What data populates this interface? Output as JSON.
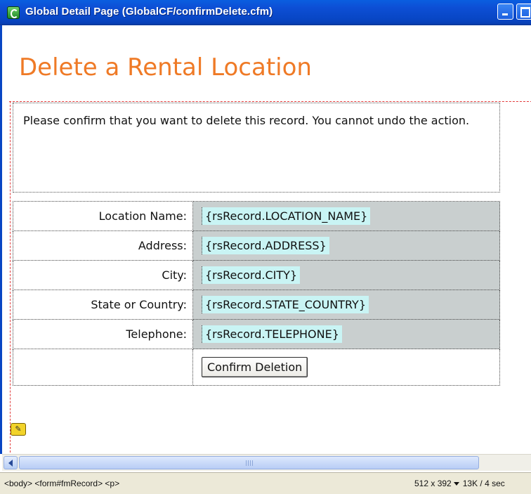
{
  "window": {
    "title": "Global Detail Page (GlobalCF/confirmDelete.cfm)"
  },
  "page": {
    "title": "Delete a Rental Location",
    "confirm_message": "Please confirm that you want to delete this record. You cannot undo the action."
  },
  "form": {
    "fields": [
      {
        "label": "Location Name:",
        "value": "{rsRecord.LOCATION_NAME}"
      },
      {
        "label": "Address:",
        "value": "{rsRecord.ADDRESS}"
      },
      {
        "label": "City:",
        "value": "{rsRecord.CITY}"
      },
      {
        "label": "State or Country:",
        "value": "{rsRecord.STATE_COUNTRY}"
      },
      {
        "label": "Telephone:",
        "value": "{rsRecord.TELEPHONE}"
      }
    ],
    "submit_label": "Confirm Deletion"
  },
  "statusbar": {
    "tag_selector": "<body> <form#fmRecord> <p>",
    "window_size": "512 x 392",
    "download_stats": "13K / 4 sec"
  },
  "colors": {
    "title_orange": "#ef7a26",
    "field_bg": "#c9cfcf",
    "binding_highlight": "#c9f4f4",
    "titlebar_blue": "#0846c4"
  }
}
